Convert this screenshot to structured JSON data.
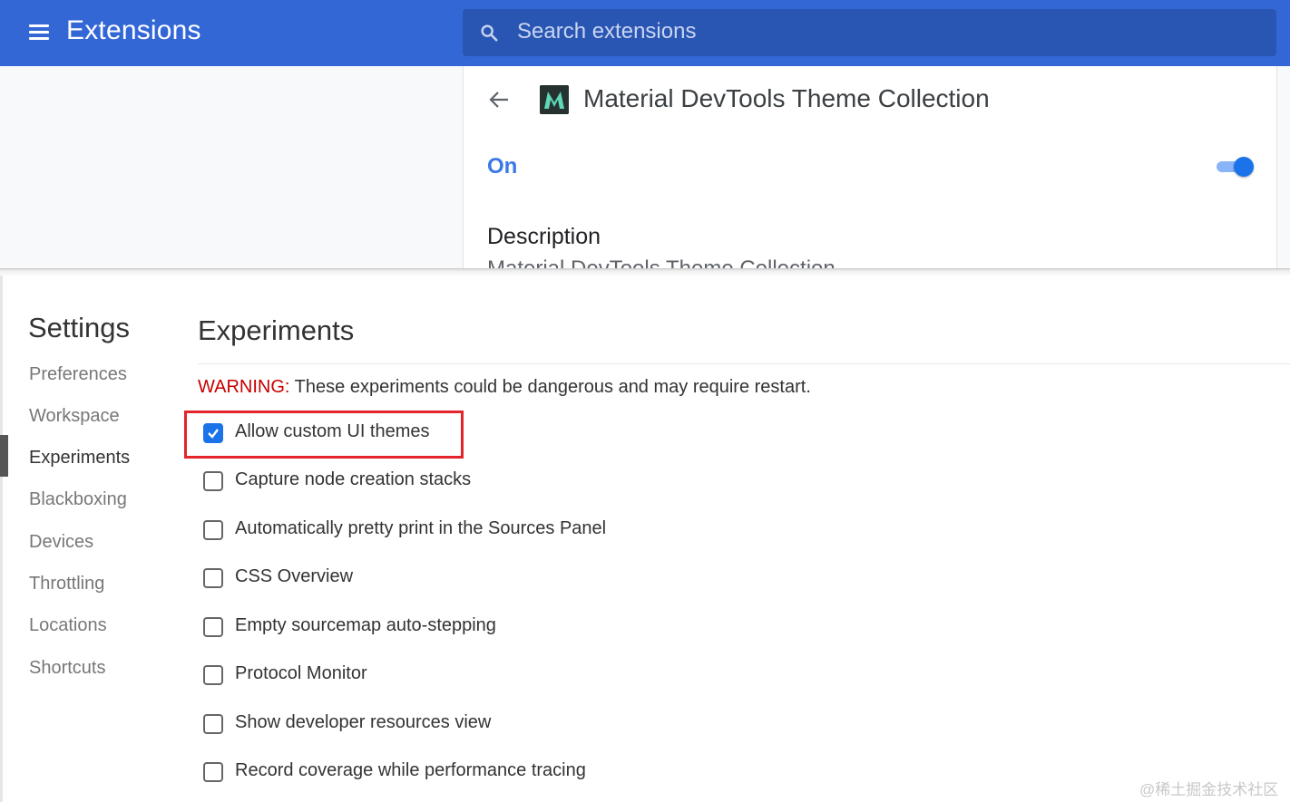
{
  "extensions": {
    "title": "Extensions",
    "search_placeholder": "Search extensions",
    "extension_name": "Material DevTools Theme Collection",
    "status_label": "On",
    "enabled": true,
    "description_heading": "Description",
    "description_text": "Material DevTools Theme Collection"
  },
  "settings": {
    "title": "Settings",
    "nav": [
      {
        "label": "Preferences",
        "active": false
      },
      {
        "label": "Workspace",
        "active": false
      },
      {
        "label": "Experiments",
        "active": true
      },
      {
        "label": "Blackboxing",
        "active": false
      },
      {
        "label": "Devices",
        "active": false
      },
      {
        "label": "Throttling",
        "active": false
      },
      {
        "label": "Locations",
        "active": false
      },
      {
        "label": "Shortcuts",
        "active": false
      }
    ],
    "panel_title": "Experiments",
    "warning_label": "WARNING:",
    "warning_text": " These experiments could be dangerous and may require restart.",
    "experiments": [
      {
        "label": "Allow custom UI themes",
        "checked": true
      },
      {
        "label": "Capture node creation stacks",
        "checked": false
      },
      {
        "label": "Automatically pretty print in the Sources Panel",
        "checked": false
      },
      {
        "label": "CSS Overview",
        "checked": false
      },
      {
        "label": "Empty sourcemap auto-stepping",
        "checked": false
      },
      {
        "label": "Protocol Monitor",
        "checked": false
      },
      {
        "label": "Show developer resources view",
        "checked": false
      },
      {
        "label": "Record coverage while performance tracing",
        "checked": false
      }
    ]
  },
  "watermark": "@稀土掘金技术社区",
  "colors": {
    "header_blue": "#3367d6",
    "accent_blue": "#1a73e8",
    "warning_red": "#c80000",
    "highlight_red": "#e3242b"
  }
}
